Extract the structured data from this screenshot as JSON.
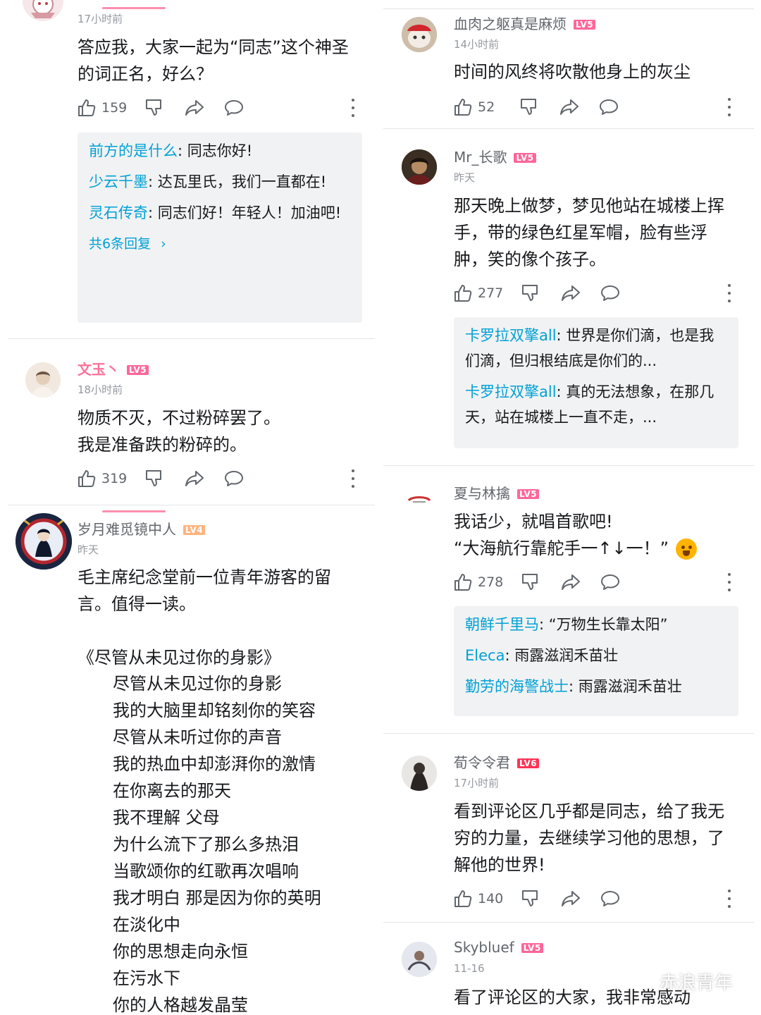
{
  "left": {
    "c1": {
      "time": "17小时前",
      "text": "答应我，大家一起为“同志”这个神圣的词正名，好么？",
      "likes": "159",
      "replies": [
        {
          "name": "前方的是什么",
          "text": ": 同志你好!"
        },
        {
          "name": "少云千墨",
          "text": ": 达瓦里氏，我们一直都在!"
        },
        {
          "name": "灵石传奇",
          "text": ": 同志们好！年轻人！加油吧!"
        }
      ],
      "replies_more": "共6条回复"
    },
    "c2": {
      "user": "文玉丶",
      "level": "LV5",
      "time": "18小时前",
      "line1": "物质不灭，不过粉碎罢了。",
      "line2": "我是准备跌的粉碎的。",
      "likes": "319"
    },
    "c3": {
      "user": "岁月难觅镜中人",
      "level": "LV4",
      "time": "昨天",
      "text": "毛主席纪念堂前一位青年游客的留言。值得一读。",
      "poem_title": "《尽管从未见过你的身影》",
      "poem": [
        "尽管从未见过你的身影",
        "我的大脑里却铭刻你的笑容",
        "尽管从未听过你的声音",
        "我的热血中却澎湃你的激情",
        "在你离去的那天",
        "我不理解 父母",
        "为什么流下了那么多热泪",
        "当歌颂你的红歌再次唱响",
        "我才明白 那是因为你的英明",
        "在淡化中",
        "你的思想走向永恒",
        "在污水下",
        "你的人格越发晶莹"
      ]
    }
  },
  "right": {
    "c1": {
      "user": "血肉之躯真是麻烦",
      "level": "LV5",
      "time": "14小时前",
      "text": "时间的风终将吹散他身上的灰尘",
      "likes": "52"
    },
    "c2": {
      "user": "Mr_长歌",
      "level": "LV5",
      "time": "昨天",
      "text": "那天晚上做梦，梦见他站在城楼上挥手，带的绿色红星军帽，脸有些浮肿，笑的像个孩子。",
      "likes": "277",
      "replies": [
        {
          "name": "卡罗拉双擎all",
          "text": ": 世界是你们滴，也是我们滴，但归根结底是你们的..."
        },
        {
          "name": "卡罗拉双擎all",
          "text": ": 真的无法想象，在那几天，站在城楼上一直不走，..."
        }
      ]
    },
    "c3": {
      "user": "夏与林擒",
      "level": "LV5",
      "line1": "我话少，就唱首歌吧!",
      "line2": "“大海航行靠舵手一↑↓一！”",
      "likes": "278",
      "replies": [
        {
          "name": "朝鲜千里马",
          "text": ": “万物生长靠太阳”"
        },
        {
          "name": "Eleca",
          "text": ": 雨露滋润禾苗壮"
        },
        {
          "name": "勤劳的海警战士",
          "text": ": 雨露滋润禾苗壮"
        }
      ]
    },
    "c4": {
      "user": "荀令令君",
      "level": "LV6",
      "time": "17小时前",
      "text": "看到评论区几乎都是同志，给了我无穷的力量，去继续学习他的思想，了解他的世界!",
      "likes": "140"
    },
    "c5": {
      "user": "Skybluef",
      "level": "LV5",
      "time": "11-16",
      "text": "看了评论区的大家，我非常感动"
    }
  },
  "watermark": "赤浪青年",
  "icons": [
    "like-icon",
    "dislike-icon",
    "share-icon",
    "reply-icon",
    "more-icon",
    "wechat-icon"
  ]
}
